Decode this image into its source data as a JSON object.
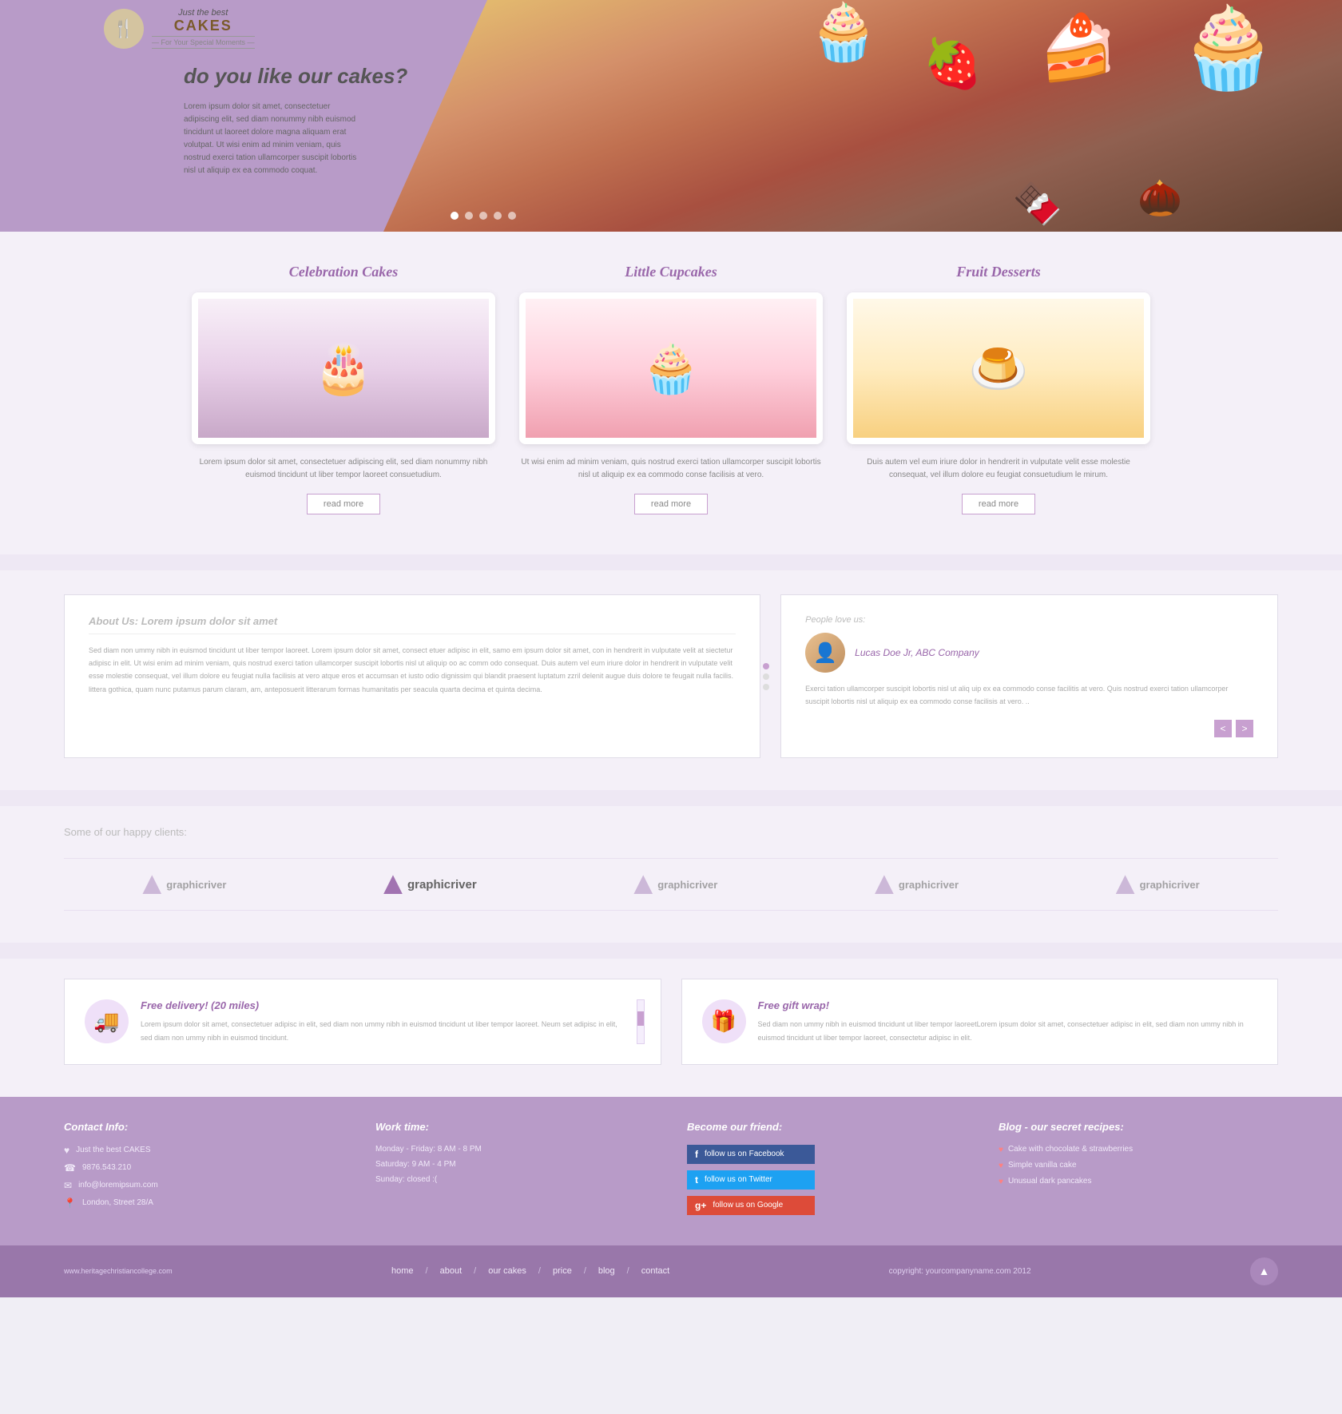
{
  "site": {
    "url": "www.heritagechristiancollege.com",
    "copyright": "copyright: yourcompanyname.com 2012"
  },
  "logo": {
    "just": "Just the best",
    "cakes": "CAKES",
    "tagline": "— For Your Special Moments —",
    "icon": "🍴"
  },
  "nav": {
    "home": "home",
    "about": "about",
    "our_cakes": "our cakes",
    "price": "price",
    "blog": "blog",
    "contact": "contact",
    "separator": "/"
  },
  "hero": {
    "title": "do you like our cakes?",
    "text": "Lorem ipsum dolor sit amet, consectetuer adipiscing elit, sed diam nonummy nibh euismod tincidunt ut laoreet dolore magna aliquam erat volutpat. Ut wisi enim ad minim veniam, quis nostrud exerci tation ullamcorper suscipit lobortis nisl ut aliquip ex ea commodo coquat.",
    "dots": 5
  },
  "products": {
    "title_1": "Celebration Cakes",
    "title_2": "Little Cupcakes",
    "title_3": "Fruit Desserts",
    "text_1": "Lorem ipsum dolor sit amet, consectetuer adipiscing elit, sed diam nonummy nibh euismod tincidunt ut liber tempor laoreet consuetudium.",
    "text_2": "Ut wisi enim ad minim veniam, quis nostrud exerci tation ullamcorper suscipit lobortis nisl ut aliquip ex ea commodo conse facilisis at vero.",
    "text_3": "Duis autem vel eum iriure dolor in hendrerit in vulputate velit esse molestie consequat, vel illum dolore eu feugiat consuetudium le mirum.",
    "read_more": "read more"
  },
  "about": {
    "title": "About Us: Lorem ipsum dolor sit amet",
    "text": "Sed diam non ummy nibh in euismod tincidunt ut liber tempor laoreet. Lorem ipsum dolor sit amet, consect etuer adipisc in elit, samo em ipsum dolor sit amet, con in hendrerit in vulputate velit at siectetur adipisc in elit. Ut wisi enim ad minim veniam, quis nostrud exerci tation ullamcorper suscipit lobortis nisl ut aliquip oo ac comm odo consequat. Duis autem vel eum iriure dolor in hendrerit in vulputate velit esse molestie consequat, vel illum dolore eu feugiat nulla facilisis at vero atque eros et accumsan et iusto odio dignissim qui blandit praesent luptatum zzril delenit augue duis dolore te feugait nulla facilis. littera gothica, quam nunc putamus parum claram, am, anteposuerit litterarum formas humanitatis per seacula quarta decima et quinta decima."
  },
  "testimonial": {
    "label": "People love us:",
    "name": "Lucas Doe Jr, ABC Company",
    "text": "Exerci tation ullamcorper suscipit lobortis nisl ut aliq uip ex ea commodo conse facilitis at vero. Quis nostrud exerci tation ullamcorper suscipit lobortis nisl ut aliquip ex ea commodo conse facilisis at vero. ..",
    "nav_prev": "<",
    "nav_next": ">"
  },
  "clients": {
    "title": "Some of our happy clients:",
    "logos": [
      "graphicriver",
      "graphicriver",
      "graphicriver",
      "graphicriver",
      "graphicriver"
    ]
  },
  "delivery": {
    "free_delivery_title": "Free delivery! (20 miles)",
    "free_delivery_text": "Lorem ipsum dolor sit amet, consectetuer adipisc in elit, sed diam non ummy nibh in euismod tincidunt ut liber tempor laoreet. Neum set adipisc in elit, sed diam non ummy nibh in euismod tincidunt.",
    "free_gift_title": "Free gift wrap!",
    "free_gift_text": "Sed diam non ummy nibh in euismod tincidunt ut liber tempor laoreetLorem ipsum dolor sit amet, consectetuer adipisc in elit, sed diam non ummy nibh in euismod tincidunt ut liber tempor laoreet, consectetur adipisc in elit."
  },
  "footer": {
    "contact_title": "Contact Info:",
    "contact_items": [
      {
        "icon": "♥",
        "text": "Just the best CAKES"
      },
      {
        "icon": "☎",
        "text": "9876.543.210"
      },
      {
        "icon": "✉",
        "text": "info@loremipsum.com"
      },
      {
        "icon": "📍",
        "text": "London, Street 28/A"
      }
    ],
    "work_title": "Work time:",
    "work_items": [
      "Monday - Friday: 8 AM - 8 PM",
      "Saturday: 9 AM - 4 PM",
      "Sunday: closed :("
    ],
    "social_title": "Become our friend:",
    "social_facebook": "follow us on Facebook",
    "social_twitter": "follow us on Twitter",
    "social_google": "follow us on Google",
    "blog_title": "Blog - our secret recipes:",
    "blog_items": [
      "Cake with chocolate & strawberries",
      "Simple vanilla cake",
      "Unusual dark pancakes"
    ]
  },
  "bottom_nav": {
    "home": "home",
    "about": "about",
    "our_cakes": "our cakes",
    "price": "price",
    "blog": "blog",
    "contact": "contact",
    "separator": "/"
  }
}
